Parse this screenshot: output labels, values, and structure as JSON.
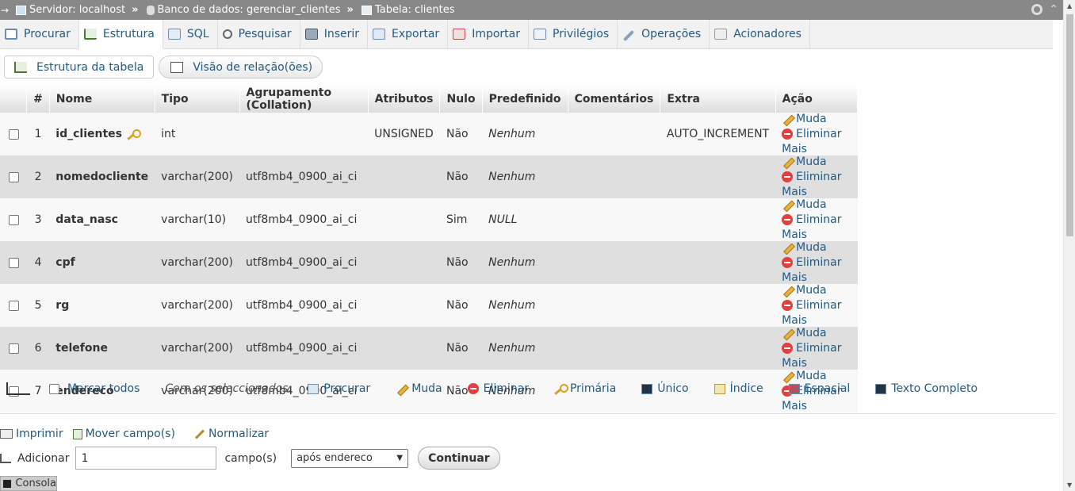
{
  "breadcrumb": {
    "server": "Servidor: localhost",
    "database": "Banco de dados: gerenciar_clientes",
    "table": "Tabela: clientes",
    "separator": "»"
  },
  "tabs": [
    {
      "label": "Procurar",
      "icon": "browse-icon"
    },
    {
      "label": "Estrutura",
      "icon": "structure-icon",
      "active": true
    },
    {
      "label": "SQL",
      "icon": "sql-icon"
    },
    {
      "label": "Pesquisar",
      "icon": "search-icon"
    },
    {
      "label": "Inserir",
      "icon": "insert-icon"
    },
    {
      "label": "Exportar",
      "icon": "export-icon"
    },
    {
      "label": "Importar",
      "icon": "import-icon"
    },
    {
      "label": "Privilégios",
      "icon": "privileges-icon"
    },
    {
      "label": "Operações",
      "icon": "operations-icon"
    },
    {
      "label": "Acionadores",
      "icon": "triggers-icon"
    }
  ],
  "subnav": {
    "table_structure": "Estrutura da tabela",
    "relation_view": "Visão de relação(ões)"
  },
  "table": {
    "headers": [
      "#",
      "Nome",
      "Tipo",
      "Agrupamento (Collation)",
      "Atributos",
      "Nulo",
      "Predefinido",
      "Comentários",
      "Extra",
      "Ação"
    ],
    "rows": [
      {
        "num": "1",
        "name": "id_clientes",
        "type": "int",
        "collation": "",
        "attributes": "UNSIGNED",
        "null": "Não",
        "default": "Nenhum",
        "comments": "",
        "extra": "AUTO_INCREMENT"
      },
      {
        "num": "2",
        "name": "nomedocliente",
        "type": "varchar(200)",
        "collation": "utf8mb4_0900_ai_ci",
        "attributes": "",
        "null": "Não",
        "default": "Nenhum",
        "comments": "",
        "extra": ""
      },
      {
        "num": "3",
        "name": "data_nasc",
        "type": "varchar(10)",
        "collation": "utf8mb4_0900_ai_ci",
        "attributes": "",
        "null": "Sim",
        "default": "NULL",
        "comments": "",
        "extra": ""
      },
      {
        "num": "4",
        "name": "cpf",
        "type": "varchar(200)",
        "collation": "utf8mb4_0900_ai_ci",
        "attributes": "",
        "null": "Não",
        "default": "Nenhum",
        "comments": "",
        "extra": ""
      },
      {
        "num": "5",
        "name": "rg",
        "type": "varchar(200)",
        "collation": "utf8mb4_0900_ai_ci",
        "attributes": "",
        "null": "Não",
        "default": "Nenhum",
        "comments": "",
        "extra": ""
      },
      {
        "num": "6",
        "name": "telefone",
        "type": "varchar(200)",
        "collation": "utf8mb4_0900_ai_ci",
        "attributes": "",
        "null": "Não",
        "default": "Nenhum",
        "comments": "",
        "extra": ""
      },
      {
        "num": "7",
        "name": "endereco",
        "type": "varchar(200)",
        "collation": "utf8mb4_0900_ai_ci",
        "attributes": "",
        "null": "Não",
        "default": "Nenhum",
        "comments": "",
        "extra": ""
      }
    ],
    "actions": {
      "change": "Muda",
      "drop": "Eliminar",
      "more": "Mais"
    }
  },
  "bulk": {
    "check_all": "Marcar todos",
    "with_selected": "Com os seleccionados:",
    "items": [
      "Procurar",
      "Muda",
      "Eliminar",
      "Primária",
      "Único",
      "Índice",
      "Espacial",
      "Texto Completo"
    ]
  },
  "footer_links": {
    "print": "Imprimir",
    "move_columns": "Mover campo(s)",
    "normalize": "Normalizar"
  },
  "add_field": {
    "label": "Adicionar",
    "count_value": "1",
    "unit": "campo(s)",
    "position_selected": "após endereco",
    "submit": "Continuar"
  },
  "console": {
    "label": "Consola"
  },
  "colors": {
    "link": "#235a81",
    "crumb_bg": "#888888"
  }
}
